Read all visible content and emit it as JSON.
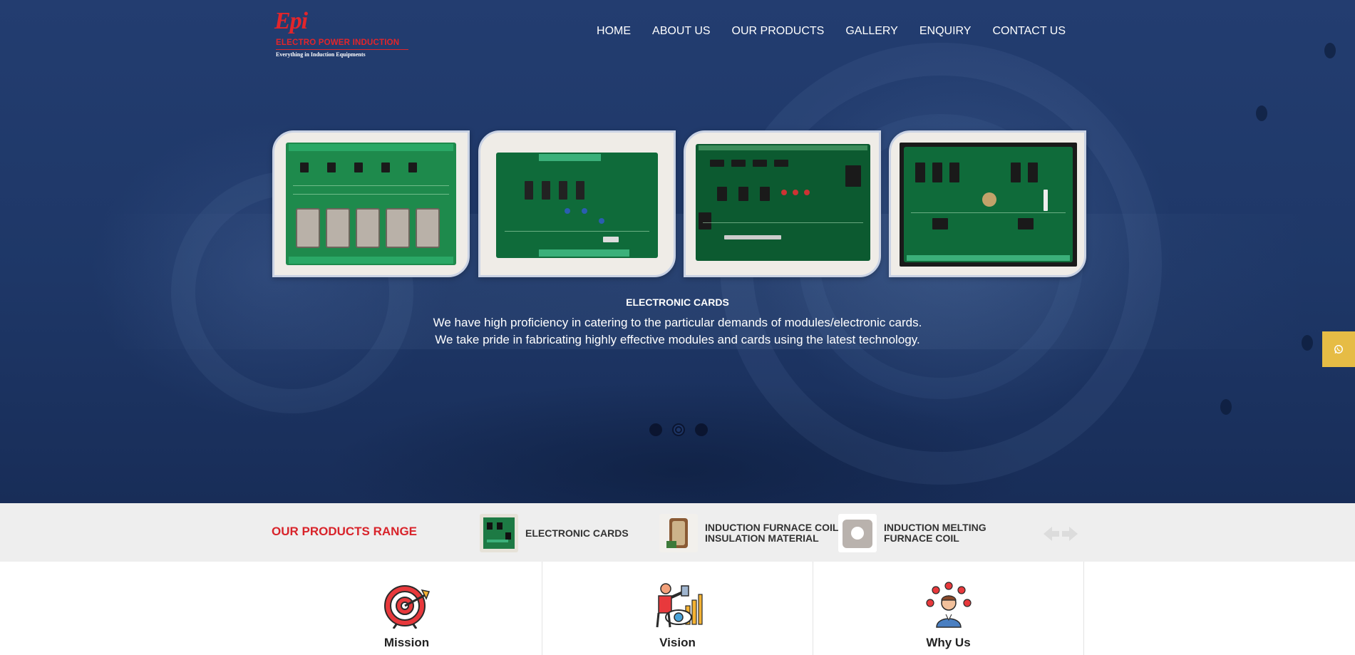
{
  "brand": {
    "mark": "Epi",
    "name": "ELECTRO POWER INDUCTION",
    "tagline": "Everything in Induction Equipments",
    "brand_color": "#e2252b"
  },
  "nav": {
    "items": [
      {
        "label": "HOME"
      },
      {
        "label": "ABOUT US"
      },
      {
        "label": "OUR PRODUCTS"
      },
      {
        "label": "GALLERY"
      },
      {
        "label": "ENQUIRY"
      },
      {
        "label": "CONTACT US"
      }
    ]
  },
  "slider": {
    "cards": [
      {
        "icon": "electronic-card-image"
      },
      {
        "icon": "electronic-card-image"
      },
      {
        "icon": "electronic-card-image"
      },
      {
        "icon": "electronic-card-image"
      }
    ],
    "title": "ELECTRONIC CARDS",
    "line1": "We have high proficiency in catering to the particular demands of modules/electronic cards.",
    "line2": "We take pride in fabricating highly effective modules and cards using the latest technology.",
    "dot_count": 3,
    "active_dot": 1
  },
  "whatsapp": {
    "icon": "whatsapp-icon",
    "color": "#e6bc45"
  },
  "products_range": {
    "title": "OUR PRODUCTS RANGE",
    "title_color": "#d8232a",
    "items": [
      {
        "label": "ELECTRONIC CARDS",
        "icon": "electronic-card-thumb"
      },
      {
        "label": "INDUCTION FURNACE COIL\nINSULATION MATERIAL",
        "icon": "coil-insulation-thumb"
      },
      {
        "label": "INDUCTION MELTING\nFURNACE COIL",
        "icon": "melting-coil-thumb"
      }
    ],
    "arrows_icon": "left-right-arrows-icon"
  },
  "features": [
    {
      "label": "Mission",
      "icon": "target-icon"
    },
    {
      "label": "Vision",
      "icon": "vision-icon"
    },
    {
      "label": "Why Us",
      "icon": "why-us-icon"
    }
  ]
}
